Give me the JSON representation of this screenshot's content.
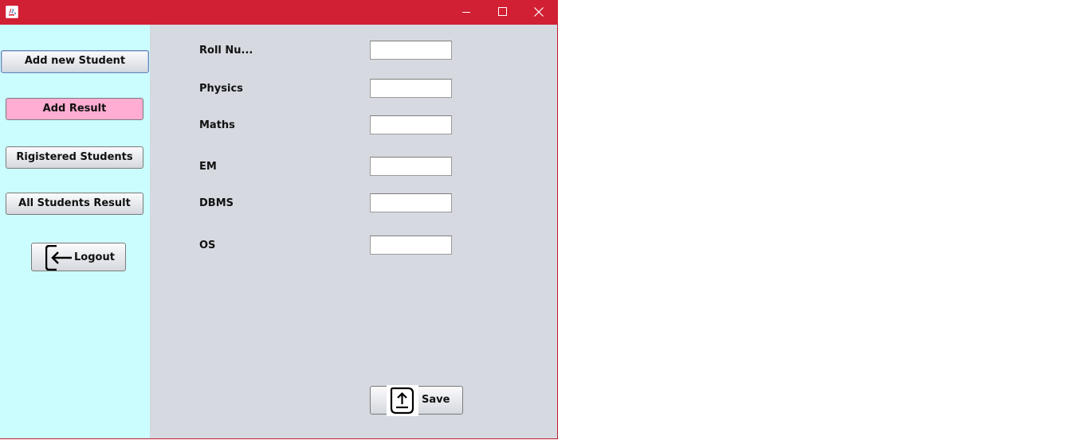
{
  "window": {
    "controls": {
      "minimize": "minimize-icon",
      "maximize": "maximize-icon",
      "close": "close-icon"
    },
    "app_icon": "java-icon"
  },
  "sidebar": {
    "buttons": {
      "add_new_student": "Add new Student",
      "add_result": "Add Result",
      "registered_students": "Rigistered Students",
      "all_students_result": "All Students Result",
      "logout": "Logout"
    }
  },
  "form": {
    "fields": [
      {
        "label": "Roll Nu...",
        "value": ""
      },
      {
        "label": "Physics",
        "value": ""
      },
      {
        "label": "Maths",
        "value": ""
      },
      {
        "label": "EM",
        "value": ""
      },
      {
        "label": "DBMS",
        "value": ""
      },
      {
        "label": "OS",
        "value": ""
      }
    ],
    "save_label": "Save"
  },
  "colors": {
    "titlebar": "#d11f33",
    "sidebar_bg": "#ccfdfe",
    "content_bg": "#d6d9e0",
    "active_button": "#ffadd2"
  }
}
